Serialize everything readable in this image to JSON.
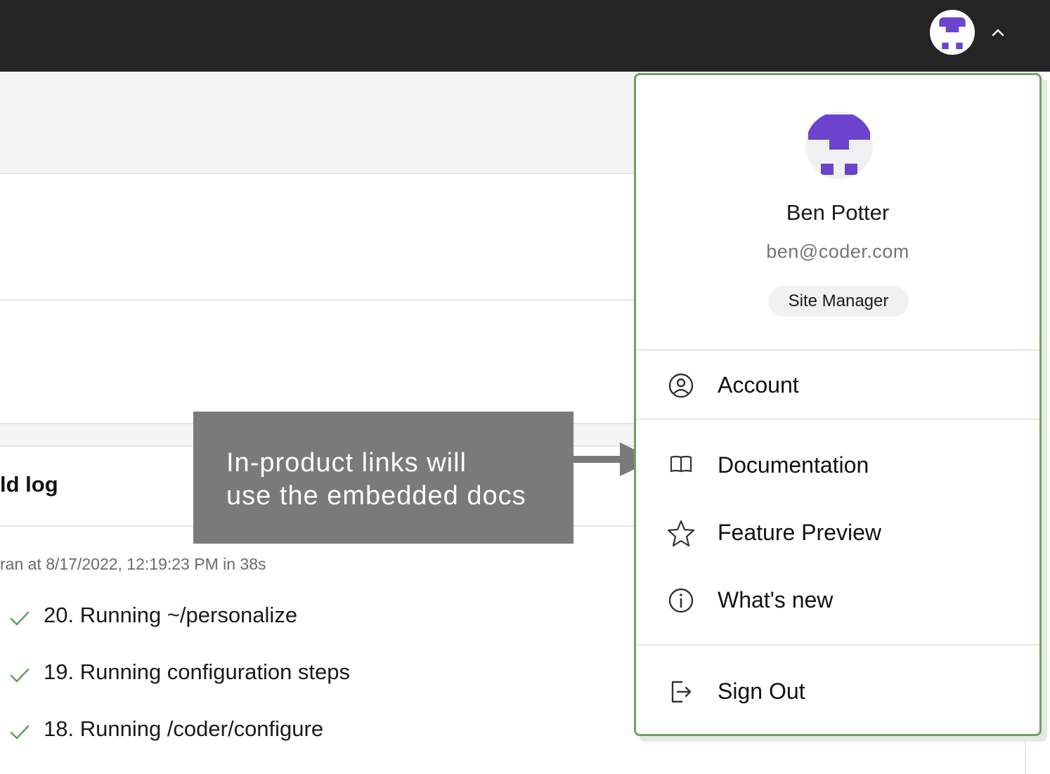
{
  "colors": {
    "topbar": "#242424",
    "accent_purple": "#6b43cc",
    "menu_border": "#6ea262",
    "check_green": "#5aa35a",
    "callout_bg": "#7a7a7a"
  },
  "topbar": {
    "avatar_icon": "user-avatar-icon",
    "chevron_icon": "chevron-up-icon"
  },
  "page": {
    "build_log_title": "ld log",
    "ran_at": "ran at 8/17/2022, 12:19:23 PM in 38s",
    "log_steps": [
      {
        "text": "20. Running ~/personalize",
        "icon": "check-icon"
      },
      {
        "text": "19. Running configuration steps",
        "icon": "check-icon"
      },
      {
        "text": "18. Running /coder/configure",
        "icon": "check-icon"
      }
    ]
  },
  "callout": {
    "line1": "In-product links will",
    "line2": "use the embedded docs"
  },
  "menu": {
    "user_name": "Ben Potter",
    "user_email": "ben@coder.com",
    "role_badge": "Site Manager",
    "items": [
      {
        "label": "Account",
        "icon": "account-circle-icon"
      },
      {
        "label": "Documentation",
        "icon": "book-icon"
      },
      {
        "label": "Feature Preview",
        "icon": "star-icon"
      },
      {
        "label": "What's new",
        "icon": "info-icon"
      },
      {
        "label": "Sign Out",
        "icon": "sign-out-icon"
      }
    ]
  }
}
